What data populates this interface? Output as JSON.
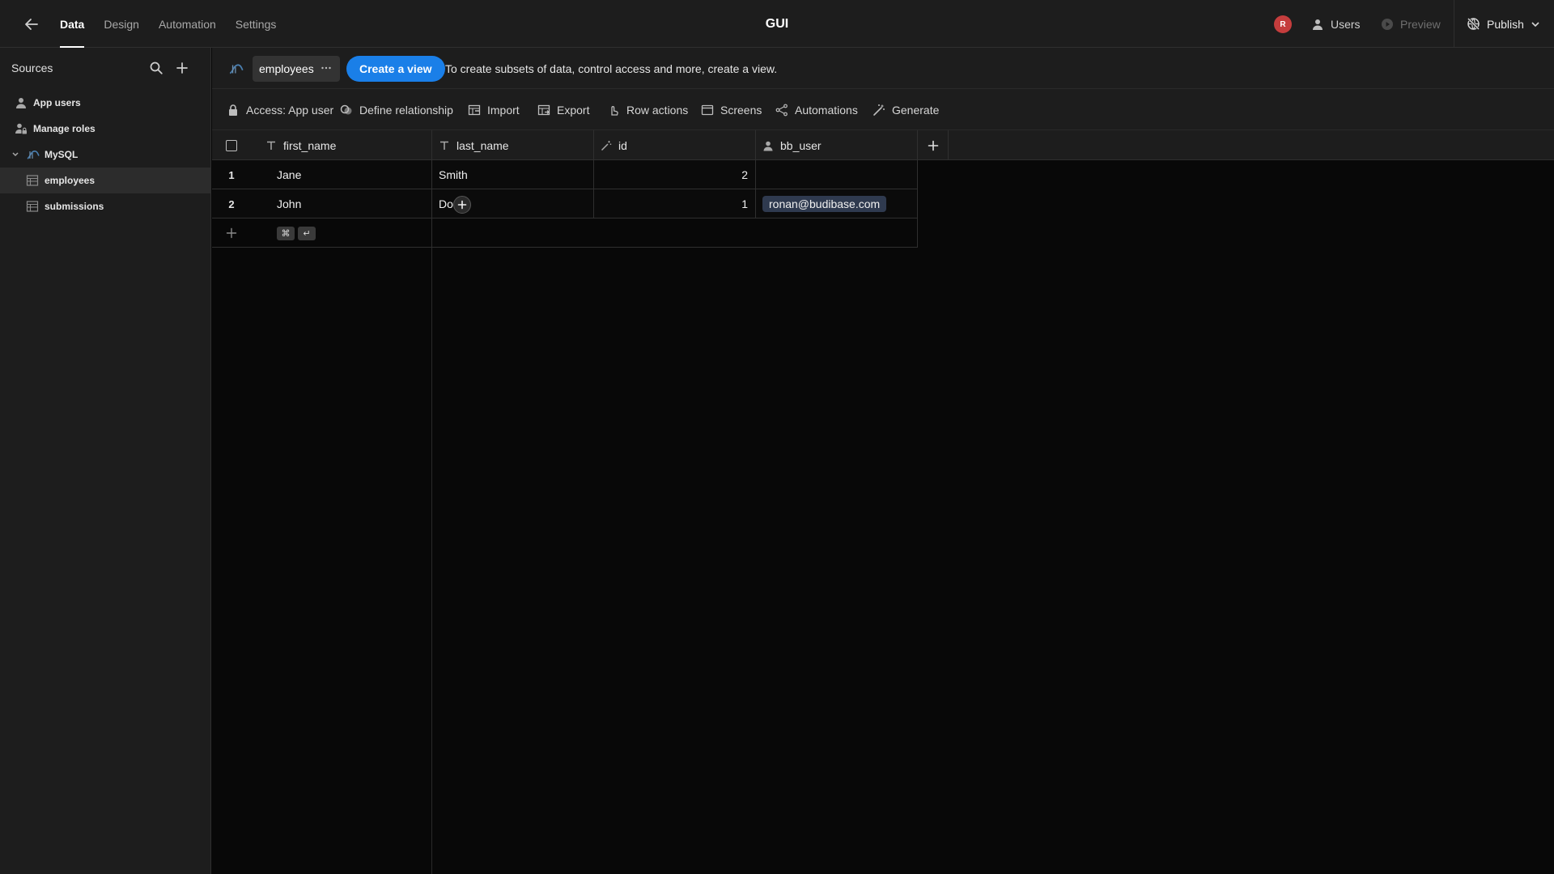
{
  "topbar": {
    "tabs": [
      {
        "label": "Data",
        "active": true
      },
      {
        "label": "Design",
        "active": false
      },
      {
        "label": "Automation",
        "active": false
      },
      {
        "label": "Settings",
        "active": false
      }
    ],
    "app_title": "GUI",
    "avatar_initial": "R",
    "users_label": "Users",
    "preview_label": "Preview",
    "publish_label": "Publish"
  },
  "sidebar": {
    "title": "Sources",
    "items": [
      {
        "label": "App users",
        "icon": "user-icon"
      },
      {
        "label": "Manage roles",
        "icon": "user-lock-icon"
      },
      {
        "label": "MySQL",
        "icon": "mysql-icon",
        "expanded": true
      },
      {
        "label": "employees",
        "icon": "table-icon",
        "selected": true
      },
      {
        "label": "submissions",
        "icon": "table-icon"
      }
    ]
  },
  "tabs_bar": {
    "table_name": "employees",
    "create_view_label": "Create a view",
    "hint": "To create subsets of data, control access and more, create a view."
  },
  "toolbar": {
    "access": "Access: App user",
    "define_relationship": "Define relationship",
    "import": "Import",
    "export": "Export",
    "row_actions": "Row actions",
    "screens": "Screens",
    "automations": "Automations",
    "generate": "Generate"
  },
  "grid": {
    "columns": [
      {
        "name": "first_name",
        "type_icon": "text-type-icon"
      },
      {
        "name": "last_name",
        "type_icon": "text-type-icon"
      },
      {
        "name": "id",
        "type_icon": "auto-id-icon"
      },
      {
        "name": "bb_user",
        "type_icon": "user-type-icon"
      }
    ],
    "rows": [
      {
        "num": "1",
        "first_name": "Jane",
        "last_name": "Smith",
        "id": "2",
        "bb_user": ""
      },
      {
        "num": "2",
        "first_name": "John",
        "last_name": "Doe",
        "id": "1",
        "bb_user": "ronan@budibase.com"
      }
    ],
    "shortcut_keys": [
      "⌘",
      "↵"
    ]
  },
  "colors": {
    "accent": "#1a7fe8",
    "avatar": "#c53d3d",
    "background": "#080808",
    "panel": "#1d1d1d"
  }
}
